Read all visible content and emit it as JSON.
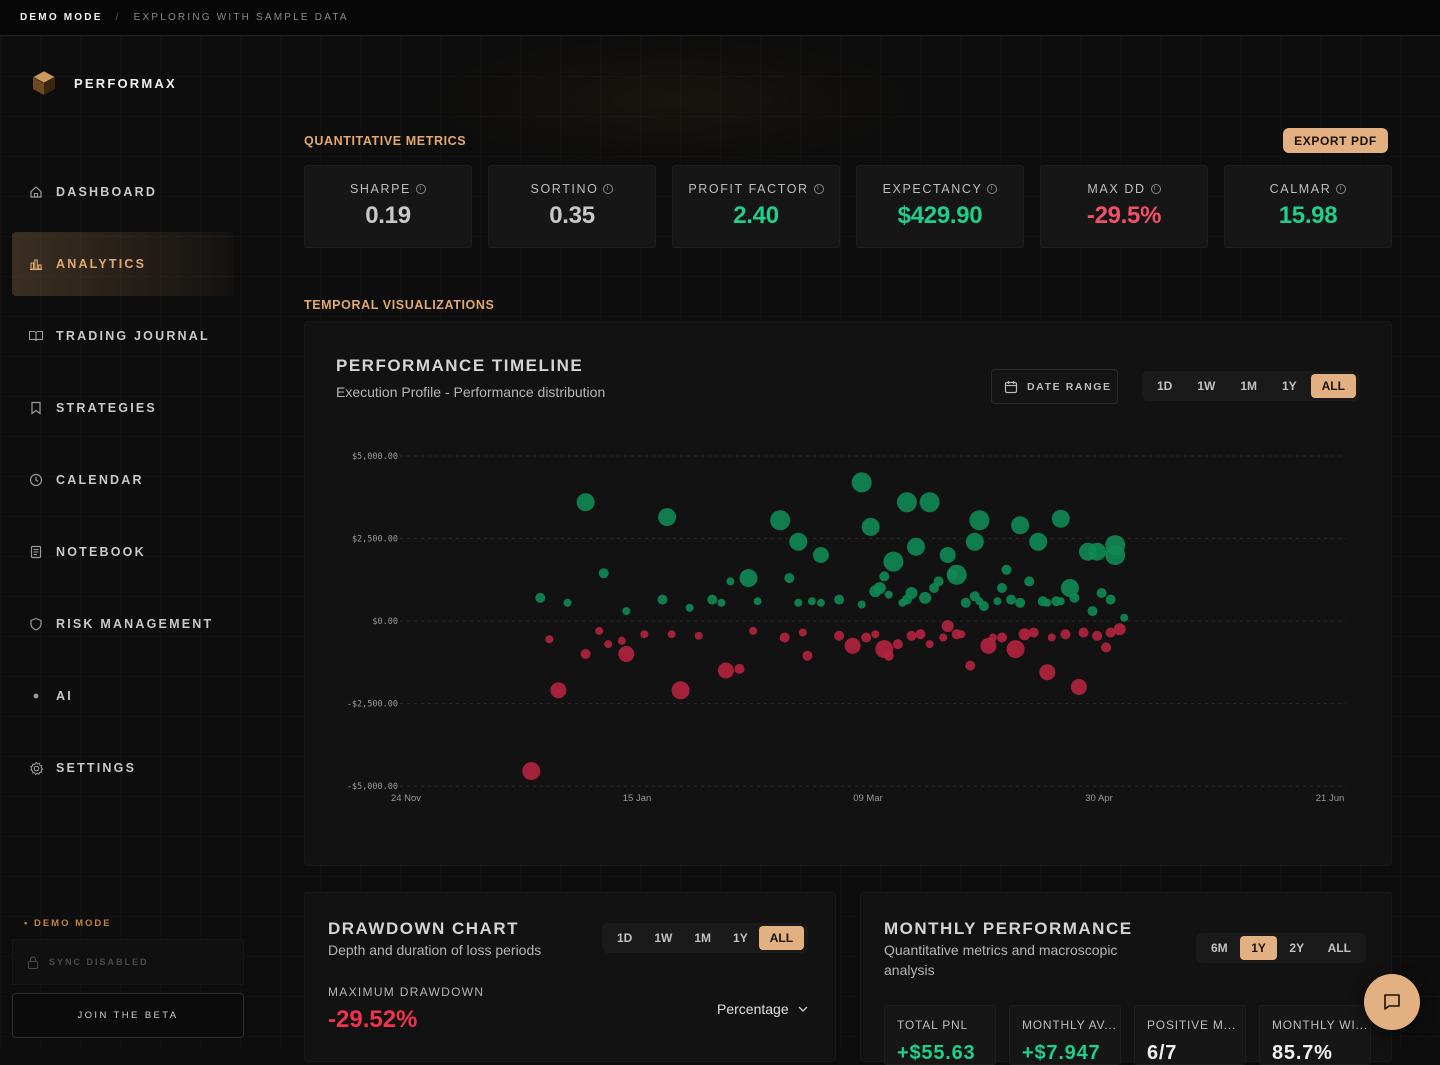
{
  "topbar": {
    "mode": "DEMO MODE",
    "separator": "/",
    "description": "EXPLORING WITH SAMPLE DATA"
  },
  "brand": {
    "name": "PERFORMAX"
  },
  "sidebar": {
    "items": [
      {
        "label": "DASHBOARD",
        "icon": "home-icon",
        "active": false
      },
      {
        "label": "ANALYTICS",
        "icon": "bar-chart-icon",
        "active": true
      },
      {
        "label": "TRADING JOURNAL",
        "icon": "book-icon",
        "active": false
      },
      {
        "label": "STRATEGIES",
        "icon": "bookmark-icon",
        "active": false
      },
      {
        "label": "CALENDAR",
        "icon": "clock-icon",
        "active": false
      },
      {
        "label": "NOTEBOOK",
        "icon": "notebook-icon",
        "active": false
      },
      {
        "label": "RISK MANAGEMENT",
        "icon": "shield-icon",
        "active": false
      },
      {
        "label": "AI",
        "icon": "dot-icon",
        "active": false
      },
      {
        "label": "SETTINGS",
        "icon": "gear-icon",
        "active": false
      }
    ],
    "demo_label": "• DEMO MODE",
    "sync_label": "SYNC DISABLED",
    "join_label": "JOIN THE BETA"
  },
  "metrics_section": {
    "title": "QUANTITATIVE METRICS",
    "export_label": "EXPORT PDF",
    "cards": [
      {
        "label": "SHARPE",
        "value": "0.19",
        "color": "#c8c8c8"
      },
      {
        "label": "SORTINO",
        "value": "0.35",
        "color": "#c8c8c8"
      },
      {
        "label": "PROFIT FACTOR",
        "value": "2.40",
        "color": "#1fcf8a"
      },
      {
        "label": "EXPECTANCY",
        "value": "$429.90",
        "color": "#1fcf8a"
      },
      {
        "label": "MAX DD",
        "value": "-29.5%",
        "color": "#f0506a"
      },
      {
        "label": "CALMAR",
        "value": "15.98",
        "color": "#1fcf8a"
      }
    ]
  },
  "temporal_section": {
    "title": "TEMPORAL VISUALIZATIONS"
  },
  "timeline": {
    "title": "PERFORMANCE TIMELINE",
    "subtitle": "Execution Profile - Performance distribution",
    "date_range_label": "DATE RANGE",
    "ranges": [
      "1D",
      "1W",
      "1M",
      "1Y",
      "ALL"
    ],
    "selected_range": "ALL"
  },
  "drawdown": {
    "title": "DRAWDOWN CHART",
    "subtitle": "Depth and duration of loss periods",
    "ranges": [
      "1D",
      "1W",
      "1M",
      "1Y",
      "ALL"
    ],
    "selected_range": "ALL",
    "max_label": "MAXIMUM DRAWDOWN",
    "max_value": "-29.52%",
    "mode_select": "Percentage"
  },
  "monthly": {
    "title": "MONTHLY PERFORMANCE",
    "subtitle_line1": "Quantitative metrics and macroscopic",
    "subtitle_line2": "analysis",
    "ranges": [
      "6M",
      "1Y",
      "2Y",
      "ALL"
    ],
    "selected_range": "1Y",
    "cards": [
      {
        "label": "TOTAL PNL",
        "value": "+$55.63",
        "color": "#1fcf8a"
      },
      {
        "label": "MONTHLY AV...",
        "value": "+$7.947",
        "color": "#1fcf8a"
      },
      {
        "label": "POSITIVE M...",
        "value": "6/7",
        "color": "#f0f0f0"
      },
      {
        "label": "MONTHLY WI...",
        "value": "85.7%",
        "color": "#f0f0f0"
      }
    ]
  },
  "chart_data": {
    "type": "scatter",
    "title": "PERFORMANCE TIMELINE",
    "x_tick_labels": [
      "24 Nov",
      "15 Jan",
      "09 Mar",
      "30 Apr",
      "21 Jun"
    ],
    "y_tick_labels": [
      "$5,000.00",
      "$2,500.00",
      "$0.00",
      "-$2,500.00",
      "-$5,000.00"
    ],
    "ylim": [
      -5000,
      5000
    ],
    "x_range_days": [
      0,
      209
    ],
    "grid": true,
    "colors": {
      "win": "#0f8a55",
      "loss": "#b5233f"
    },
    "points": [
      {
        "x": 29,
        "y": -4550,
        "s": 9
      },
      {
        "x": 31,
        "y": 700,
        "s": 5
      },
      {
        "x": 33,
        "y": -550,
        "s": 4
      },
      {
        "x": 35,
        "y": -2100,
        "s": 8
      },
      {
        "x": 37,
        "y": 550,
        "s": 4
      },
      {
        "x": 41,
        "y": 3600,
        "s": 9
      },
      {
        "x": 41,
        "y": -1000,
        "s": 5
      },
      {
        "x": 44,
        "y": -300,
        "s": 4
      },
      {
        "x": 45,
        "y": 1450,
        "s": 5
      },
      {
        "x": 46,
        "y": -700,
        "s": 4
      },
      {
        "x": 49,
        "y": -600,
        "s": 4
      },
      {
        "x": 50,
        "y": -1000,
        "s": 8
      },
      {
        "x": 50,
        "y": 300,
        "s": 4
      },
      {
        "x": 54,
        "y": -400,
        "s": 4
      },
      {
        "x": 58,
        "y": 650,
        "s": 5
      },
      {
        "x": 59,
        "y": 3150,
        "s": 9
      },
      {
        "x": 60,
        "y": -400,
        "s": 4
      },
      {
        "x": 62,
        "y": -2100,
        "s": 9
      },
      {
        "x": 64,
        "y": 400,
        "s": 4
      },
      {
        "x": 66,
        "y": -450,
        "s": 4
      },
      {
        "x": 69,
        "y": 650,
        "s": 5
      },
      {
        "x": 71,
        "y": 550,
        "s": 4
      },
      {
        "x": 72,
        "y": -1500,
        "s": 8
      },
      {
        "x": 73,
        "y": 1200,
        "s": 4
      },
      {
        "x": 75,
        "y": -1450,
        "s": 5
      },
      {
        "x": 77,
        "y": 1300,
        "s": 9
      },
      {
        "x": 78,
        "y": -300,
        "s": 4
      },
      {
        "x": 79,
        "y": 600,
        "s": 4
      },
      {
        "x": 84,
        "y": 3050,
        "s": 10
      },
      {
        "x": 85,
        "y": -500,
        "s": 5
      },
      {
        "x": 86,
        "y": 1300,
        "s": 5
      },
      {
        "x": 88,
        "y": 2400,
        "s": 9
      },
      {
        "x": 88,
        "y": 550,
        "s": 4
      },
      {
        "x": 89,
        "y": -350,
        "s": 4
      },
      {
        "x": 90,
        "y": -1050,
        "s": 5
      },
      {
        "x": 91,
        "y": 600,
        "s": 4
      },
      {
        "x": 93,
        "y": 2000,
        "s": 8
      },
      {
        "x": 93,
        "y": 550,
        "s": 4
      },
      {
        "x": 97,
        "y": -450,
        "s": 5
      },
      {
        "x": 97,
        "y": 650,
        "s": 5
      },
      {
        "x": 100,
        "y": -750,
        "s": 8
      },
      {
        "x": 102,
        "y": 4200,
        "s": 10
      },
      {
        "x": 102,
        "y": 500,
        "s": 4
      },
      {
        "x": 103,
        "y": -500,
        "s": 5
      },
      {
        "x": 104,
        "y": 2850,
        "s": 9
      },
      {
        "x": 105,
        "y": 900,
        "s": 6
      },
      {
        "x": 105,
        "y": -400,
        "s": 4
      },
      {
        "x": 106,
        "y": 1000,
        "s": 6
      },
      {
        "x": 107,
        "y": 1350,
        "s": 5
      },
      {
        "x": 107,
        "y": -850,
        "s": 9
      },
      {
        "x": 108,
        "y": 800,
        "s": 4
      },
      {
        "x": 108,
        "y": -1050,
        "s": 5
      },
      {
        "x": 109,
        "y": 1800,
        "s": 10
      },
      {
        "x": 110,
        "y": -700,
        "s": 5
      },
      {
        "x": 111,
        "y": 550,
        "s": 4
      },
      {
        "x": 112,
        "y": 3600,
        "s": 10
      },
      {
        "x": 112,
        "y": 650,
        "s": 5
      },
      {
        "x": 113,
        "y": -450,
        "s": 5
      },
      {
        "x": 113,
        "y": 850,
        "s": 6
      },
      {
        "x": 114,
        "y": 2250,
        "s": 9
      },
      {
        "x": 115,
        "y": -400,
        "s": 5
      },
      {
        "x": 116,
        "y": 700,
        "s": 6
      },
      {
        "x": 117,
        "y": -700,
        "s": 4
      },
      {
        "x": 117,
        "y": 3600,
        "s": 10
      },
      {
        "x": 118,
        "y": 1000,
        "s": 5
      },
      {
        "x": 119,
        "y": 1200,
        "s": 5
      },
      {
        "x": 120,
        "y": -500,
        "s": 4
      },
      {
        "x": 121,
        "y": -150,
        "s": 6
      },
      {
        "x": 121,
        "y": 2000,
        "s": 8
      },
      {
        "x": 122,
        "y": 1400,
        "s": 5
      },
      {
        "x": 123,
        "y": -400,
        "s": 5
      },
      {
        "x": 123,
        "y": 1400,
        "s": 10
      },
      {
        "x": 124,
        "y": -400,
        "s": 4
      },
      {
        "x": 125,
        "y": 550,
        "s": 5
      },
      {
        "x": 126,
        "y": -1350,
        "s": 5
      },
      {
        "x": 127,
        "y": 750,
        "s": 5
      },
      {
        "x": 127,
        "y": 2400,
        "s": 9
      },
      {
        "x": 128,
        "y": 600,
        "s": 4
      },
      {
        "x": 128,
        "y": 3050,
        "s": 10
      },
      {
        "x": 129,
        "y": 450,
        "s": 5
      },
      {
        "x": 130,
        "y": -750,
        "s": 8
      },
      {
        "x": 131,
        "y": -500,
        "s": 4
      },
      {
        "x": 132,
        "y": 600,
        "s": 4
      },
      {
        "x": 133,
        "y": 1000,
        "s": 5
      },
      {
        "x": 133,
        "y": -500,
        "s": 5
      },
      {
        "x": 134,
        "y": 1550,
        "s": 5
      },
      {
        "x": 135,
        "y": 650,
        "s": 5
      },
      {
        "x": 136,
        "y": -850,
        "s": 9
      },
      {
        "x": 137,
        "y": 2900,
        "s": 9
      },
      {
        "x": 137,
        "y": 550,
        "s": 5
      },
      {
        "x": 138,
        "y": -400,
        "s": 6
      },
      {
        "x": 139,
        "y": 1200,
        "s": 5
      },
      {
        "x": 140,
        "y": -350,
        "s": 5
      },
      {
        "x": 141,
        "y": 2400,
        "s": 9
      },
      {
        "x": 142,
        "y": 600,
        "s": 5
      },
      {
        "x": 143,
        "y": -1550,
        "s": 8
      },
      {
        "x": 143,
        "y": 550,
        "s": 4
      },
      {
        "x": 144,
        "y": -500,
        "s": 4
      },
      {
        "x": 145,
        "y": 600,
        "s": 5
      },
      {
        "x": 146,
        "y": 3100,
        "s": 9
      },
      {
        "x": 146,
        "y": 600,
        "s": 4
      },
      {
        "x": 147,
        "y": -400,
        "s": 5
      },
      {
        "x": 148,
        "y": 1000,
        "s": 9
      },
      {
        "x": 149,
        "y": 700,
        "s": 5
      },
      {
        "x": 150,
        "y": -2000,
        "s": 8
      },
      {
        "x": 151,
        "y": -350,
        "s": 5
      },
      {
        "x": 152,
        "y": 2100,
        "s": 9
      },
      {
        "x": 153,
        "y": 300,
        "s": 5
      },
      {
        "x": 154,
        "y": -450,
        "s": 5
      },
      {
        "x": 154,
        "y": 2100,
        "s": 9
      },
      {
        "x": 155,
        "y": 850,
        "s": 5
      },
      {
        "x": 156,
        "y": -800,
        "s": 5
      },
      {
        "x": 157,
        "y": -350,
        "s": 5
      },
      {
        "x": 157,
        "y": 650,
        "s": 5
      },
      {
        "x": 158,
        "y": 2300,
        "s": 10
      },
      {
        "x": 158,
        "y": 2000,
        "s": 10
      },
      {
        "x": 159,
        "y": -250,
        "s": 6
      },
      {
        "x": 160,
        "y": 100,
        "s": 4
      }
    ]
  }
}
